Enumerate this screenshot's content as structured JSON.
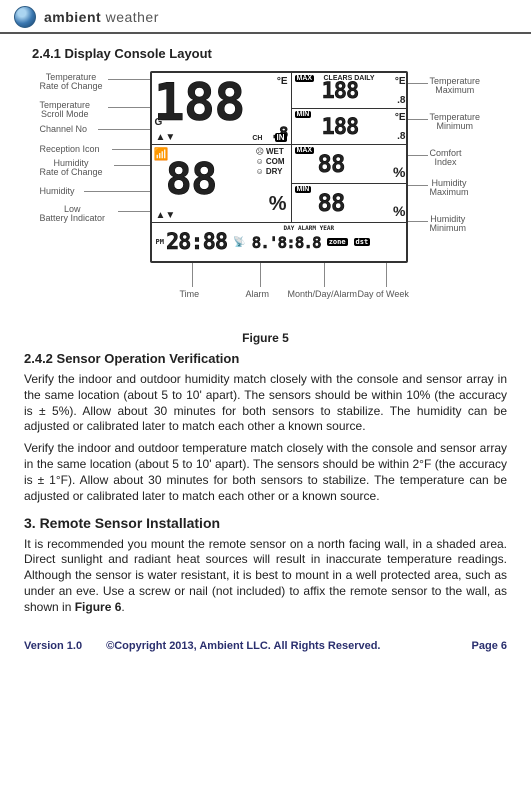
{
  "header": {
    "brand_1": "ambient",
    "brand_2": "weather"
  },
  "sections": {
    "s241_title": "2.4.1 Display Console Layout",
    "s242_title": "2.4.2 Sensor Operation Verification",
    "s3_title": "3. Remote Sensor Installation"
  },
  "figure": {
    "caption": "Figure   5",
    "lcd": {
      "big_temp": "188",
      "unit_e": "E",
      "small8": ".8",
      "trend": "▲▼",
      "g": "G",
      "in": "IN",
      "ch": "CH",
      "max": "MAX",
      "min": "MIN",
      "clears": "CLEARS  DAILY",
      "side_temp": "188",
      "tiny_e": "E",
      "tiny_8": ".8",
      "big_hum": "88",
      "pct": "%",
      "wet": "WET",
      "com": "COM",
      "dry": "DRY",
      "side_hum": "88",
      "pm": "PM",
      "time": "28:88",
      "md_label": "DAY ALARM YEAR",
      "md": "8.'8:8.8",
      "zone": "zone",
      "ds": "dst"
    },
    "left_labels": [
      "Temperature\nRate of Change",
      "Temperature\nScroll Mode",
      "Channel No",
      "Reception Icon",
      "Humidity\nRate of Change",
      "Humidity",
      "Low\nBattery Indicator"
    ],
    "right_labels": [
      "Temperature\nMaximum",
      "Temperature\nMinimum",
      "Comfort\nIndex",
      "Humidity\nMaximum",
      "Humidity\nMinimum"
    ],
    "bottom_labels": {
      "time": "Time",
      "alarm": "Alarm",
      "mda": "Month/Day/Alarm",
      "dow": "Day of Week"
    }
  },
  "body": {
    "p1": "Verify the indoor and outdoor humidity match closely with the console and sensor array in the same location (about 5 to 10' apart). The sensors should be within 10% (the accuracy is ± 5%).  Allow about 30 minutes for both sensors to stabilize. The humidity can be adjusted or calibrated later to match each other a known source.",
    "p2": "Verify the indoor and outdoor temperature match closely with the console and sensor array in the same location (about 5 to 10' apart). The sensors should be within 2°F (the accuracy is ± 1°F).  Allow about 30 minutes for both sensors to stabilize. The temperature can be adjusted or calibrated later to match each other or a known source.",
    "p3a": "It is recommended you mount the remote sensor on a north facing wall, in a shaded area. Direct sunlight and radiant heat sources will result in inaccurate temperature readings. Although the sensor is water resistant, it is best to mount in a well protected area, such as under an eve. Use a screw or nail (not included) to affix the remote sensor to the wall, as shown in ",
    "p3b": "Figure 6",
    "p3c": "."
  },
  "footer": {
    "version": "Version 1.0",
    "copyright": "©Copyright 2013, Ambient  LLC.       All Rights Reserved.",
    "page": "Page 6"
  }
}
